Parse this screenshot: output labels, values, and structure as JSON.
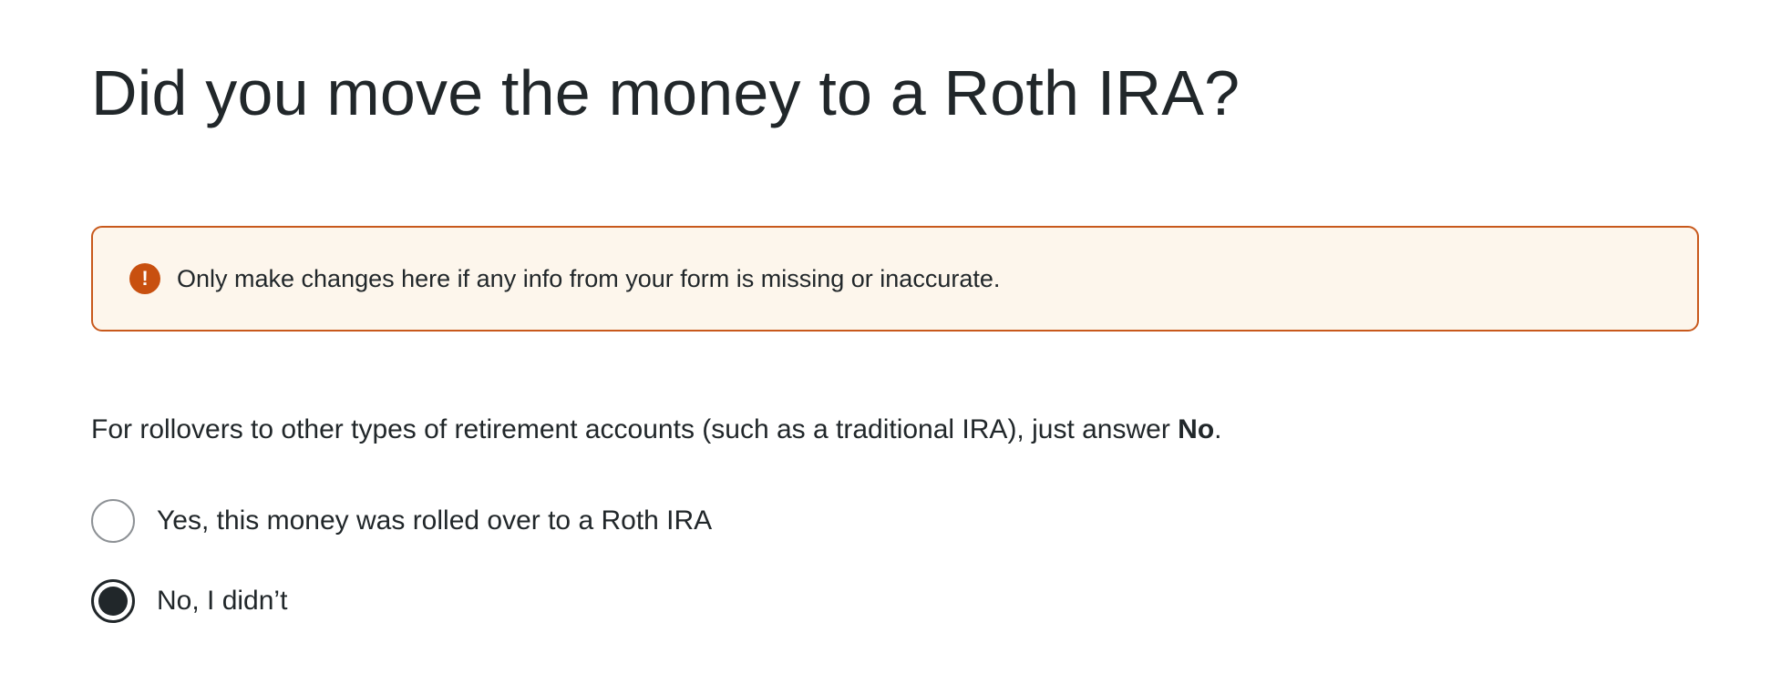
{
  "page": {
    "title": "Did you move the money to a Roth IRA?"
  },
  "alert": {
    "icon": "exclamation-icon",
    "icon_glyph": "!",
    "message": "Only make changes here if any info from your form is missing or inaccurate.",
    "border_color": "#c8591c",
    "background_color": "#fdf6ec",
    "icon_color": "#c8500f"
  },
  "instruction": {
    "text_before": "For rollovers to other types of retirement accounts (such as a traditional IRA), just answer ",
    "bold_text": "No",
    "text_after": "."
  },
  "options": [
    {
      "label": "Yes, this money was rolled over to a Roth IRA",
      "selected": false
    },
    {
      "label": "No, I didn’t",
      "selected": true
    }
  ]
}
